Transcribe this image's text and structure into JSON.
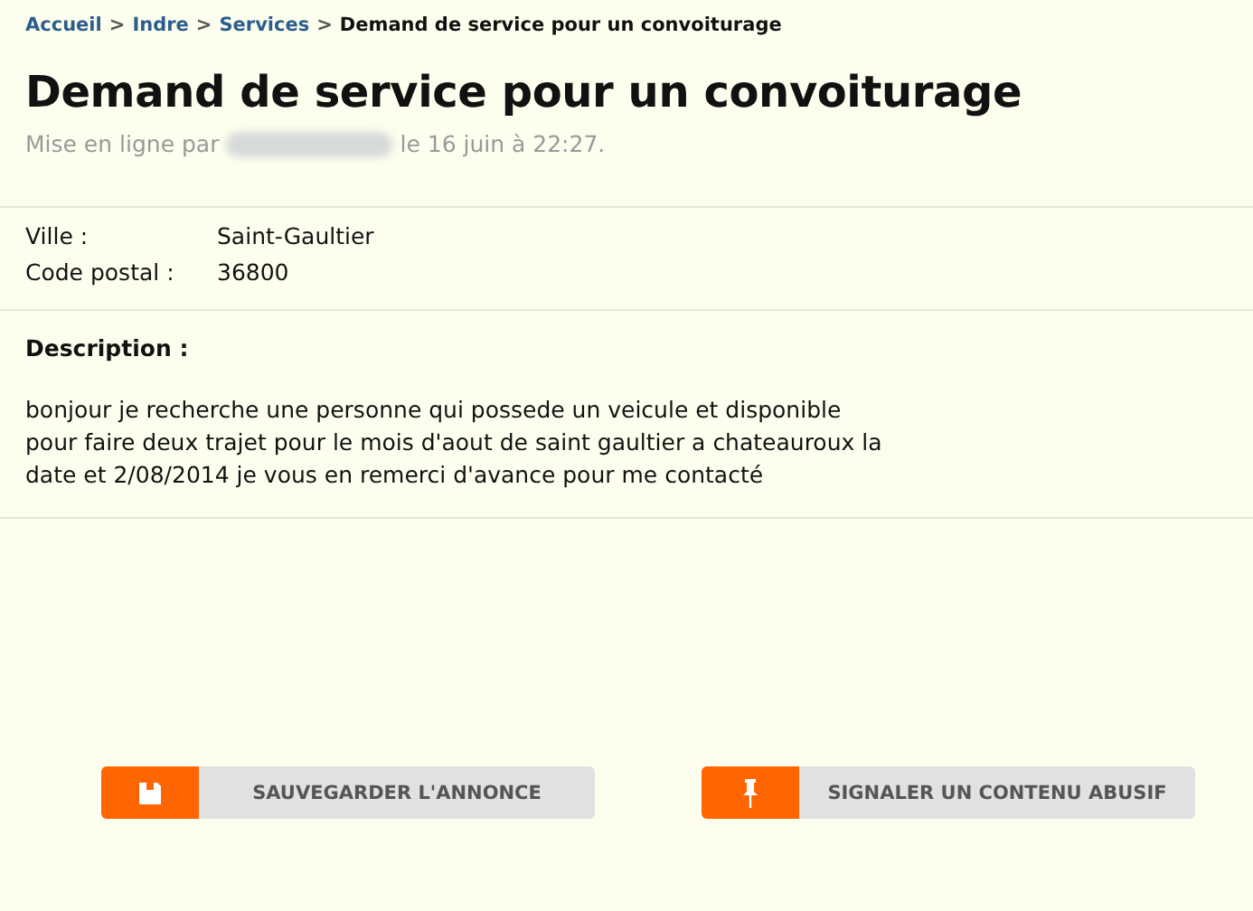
{
  "breadcrumb": [
    {
      "label": "Accueil",
      "kind": "link"
    },
    {
      "label": ">",
      "kind": "separator"
    },
    {
      "label": "Indre",
      "kind": "link"
    },
    {
      "label": ">",
      "kind": "separator"
    },
    {
      "label": "Services",
      "kind": "link"
    },
    {
      "label": ">",
      "kind": "separator"
    },
    {
      "label": "Demand de service pour un convoiturage",
      "kind": "current"
    }
  ],
  "title": "Demand de service pour un convoiturage",
  "posted": {
    "before": "Mise en ligne par",
    "after": "le 16 juin à 22:27."
  },
  "fields": [
    {
      "label": "Ville :",
      "value": "Saint-Gaultier"
    },
    {
      "label": "Code postal :",
      "value": "36800"
    }
  ],
  "description": {
    "heading": "Description :",
    "text": "bonjour je recherche une personne qui possede un veicule et disponible pour faire deux trajet pour le mois d'aout de saint gaultier a chateauroux la date et 2/08/2014 je vous en remerci d'avance pour me contacté"
  },
  "actions": [
    {
      "label": "SAUVEGARDER L'ANNONCE",
      "kind": "save"
    },
    {
      "label": "SIGNALER UN CONTENU ABUSIF",
      "kind": "report"
    }
  ]
}
